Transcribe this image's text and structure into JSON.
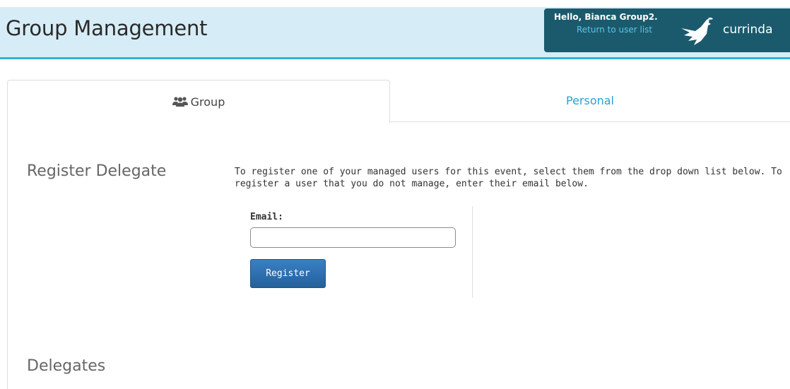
{
  "header": {
    "title": "Group Management",
    "greeting": "Hello, Bianca Group2.",
    "return_link": "Return to user list",
    "logo_text": "currinda"
  },
  "tabs": [
    {
      "label": "Group",
      "icon": "users-icon",
      "active": true
    },
    {
      "label": "Personal",
      "active": false
    }
  ],
  "register": {
    "title": "Register Delegate",
    "instructions": "To register one of your managed users for this event, select them from the drop down list below. To register a user that you do not manage, enter their email below.",
    "email_label": "Email:",
    "email_value": "",
    "button_label": "Register"
  },
  "delegates": {
    "title": "Delegates"
  },
  "colors": {
    "header_bg": "#d6edf7",
    "header_border": "#3aaed8",
    "user_box_bg": "#1b5a6d",
    "link": "#2a9fd6",
    "button": "#2a6eb0"
  }
}
